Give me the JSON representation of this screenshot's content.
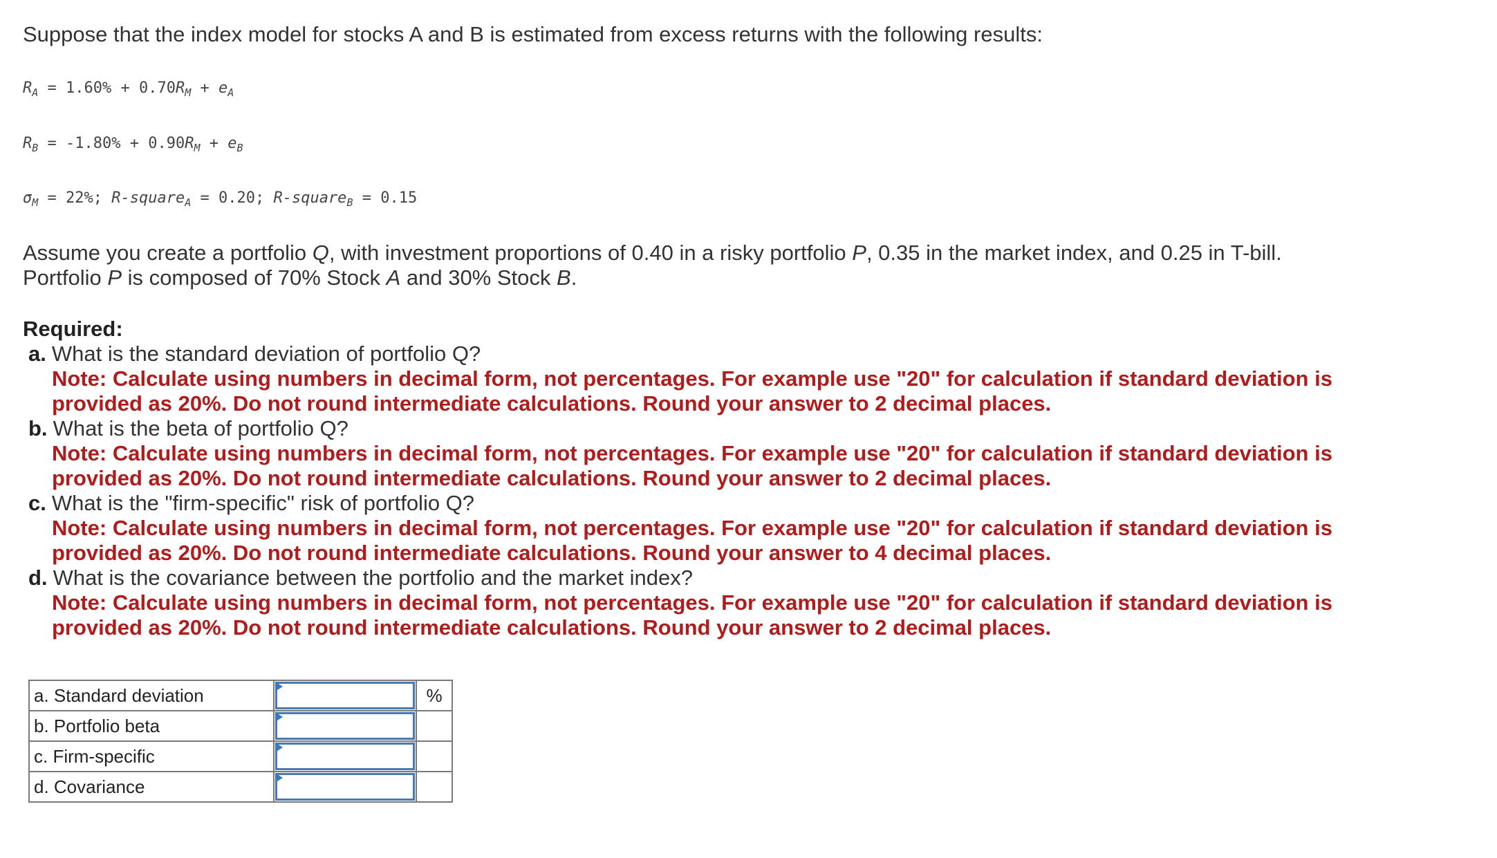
{
  "intro": "Suppose that the index model for stocks A and B is estimated from excess returns with the following results:",
  "formulas": {
    "ra": {
      "lhs": "R",
      "lhs_sub": "A",
      "rhs_a": "= 1.60% + 0.70",
      "rm": "R",
      "rm_sub": "M",
      "rhs_b": "+ ",
      "e": "e",
      "e_sub": "A"
    },
    "rb": {
      "lhs": "R",
      "lhs_sub": "B",
      "rhs_a": "= -1.80% + 0.90",
      "rm": "R",
      "rm_sub": "M",
      "rhs_b": "+ ",
      "e": "e",
      "e_sub": "B"
    },
    "sigma": {
      "sym": "σ",
      "sym_sub": "M",
      "part1": "= 22%; ",
      "rsq_a_label": "R-square",
      "rsq_a_sub": "A",
      "rsq_a_val": "= 0.20; ",
      "rsq_b_label": "R-square",
      "rsq_b_sub": "B",
      "rsq_b_val": "= 0.15"
    }
  },
  "paragraph": {
    "p1": "Assume you create a portfolio ",
    "q": "Q",
    "p2": ", with investment proportions of 0.40 in a risky portfolio ",
    "p": "P",
    "p3": ", 0.35 in the market index, and 0.25 in T-bill.",
    "p4": "Portfolio ",
    "p5": "P",
    "p6": " is composed of 70% Stock ",
    "a": "A",
    "p7": " and 30% Stock ",
    "b": "B",
    "p8": "."
  },
  "required_heading": "Required:",
  "questions": [
    {
      "letter": "a.",
      "text": "What is the standard deviation of portfolio Q?",
      "note": "Note: Calculate using numbers in decimal form, not percentages. For example use \"20\" for calculation if standard deviation is provided as 20%. Do not round intermediate calculations. Round your answer to 2 decimal places."
    },
    {
      "letter": "b.",
      "text": "What is the beta of portfolio Q?",
      "note": "Note: Calculate using numbers in decimal form, not percentages. For example use \"20\" for calculation if standard deviation is provided as 20%. Do not round intermediate calculations. Round your answer to 2 decimal places."
    },
    {
      "letter": "c.",
      "text": "What is the \"firm-specific\" risk of portfolio Q?",
      "note": "Note: Calculate using numbers in decimal form, not percentages. For example use \"20\" for calculation if standard deviation is provided as 20%. Do not round intermediate calculations. Round your answer to 4 decimal places."
    },
    {
      "letter": "d.",
      "text": "What is the covariance between the portfolio and the market index?",
      "note": "Note: Calculate using numbers in decimal form, not percentages. For example use \"20\" for calculation if standard deviation is provided as 20%. Do not round intermediate calculations. Round your answer to 2 decimal places."
    }
  ],
  "answer_table": {
    "rows": [
      {
        "label": "a. Standard deviation",
        "value": "",
        "unit": "%"
      },
      {
        "label": "b. Portfolio beta",
        "value": "",
        "unit": ""
      },
      {
        "label": "c. Firm-specific",
        "value": "",
        "unit": ""
      },
      {
        "label": "d. Covariance",
        "value": "",
        "unit": ""
      }
    ]
  },
  "colors": {
    "note_red": "#b01c1c",
    "input_border": "#4a78b0",
    "input_flag": "#3a78c3",
    "table_border": "#7a7a7a"
  }
}
